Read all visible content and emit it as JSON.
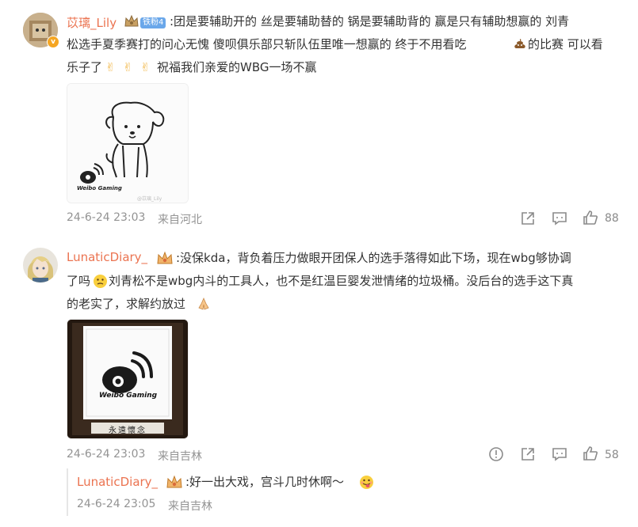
{
  "comments": [
    {
      "username": "苡璃_Lily",
      "fan_badge_label": "铁粉",
      "fan_badge_level": "4",
      "text_lines": [
        ":团是要辅助开的  丝是要辅助替的  锅是要辅助背的  赢是只有辅助想赢的  刘青",
        "松选手夏季赛打的问心无愧  傻呗俱乐部只斩队伍里唯一想赢的  终于不用看吃",
        "的比赛  可以看",
        "乐子了",
        " 祝福我们亲爱的WBG一场不赢"
      ],
      "image_caption": "Weibo Gaming",
      "image_watermark": "@苡璃_Lily",
      "timestamp": "24-6-24 23:03",
      "location": "来自河北",
      "like_count": "88"
    },
    {
      "username": "LunaticDiary_",
      "text_lines": [
        ":没保kda，背负着压力做眼开团保人的选手落得如此下场，现在wbg够协调",
        "了吗",
        "刘青松不是wbg内斗的工具人，也不是红温巨婴发泄情绪的垃圾桶。没后台的选手这下真",
        "的老实了，求解约放过"
      ],
      "image_caption": "Weibo Gaming",
      "image_footer": "永遠懷念",
      "timestamp": "24-6-24 23:03",
      "location": "来自吉林",
      "like_count": "58"
    }
  ],
  "reply": {
    "username": "LunaticDiary_",
    "text": ":好一出大戏，宫斗几时休啊～",
    "timestamp": "24-6-24 23:05",
    "location": "来自吉林"
  },
  "colors": {
    "username": "#eb7350",
    "meta": "#939393",
    "fan_badge": "#6aa7ea"
  }
}
